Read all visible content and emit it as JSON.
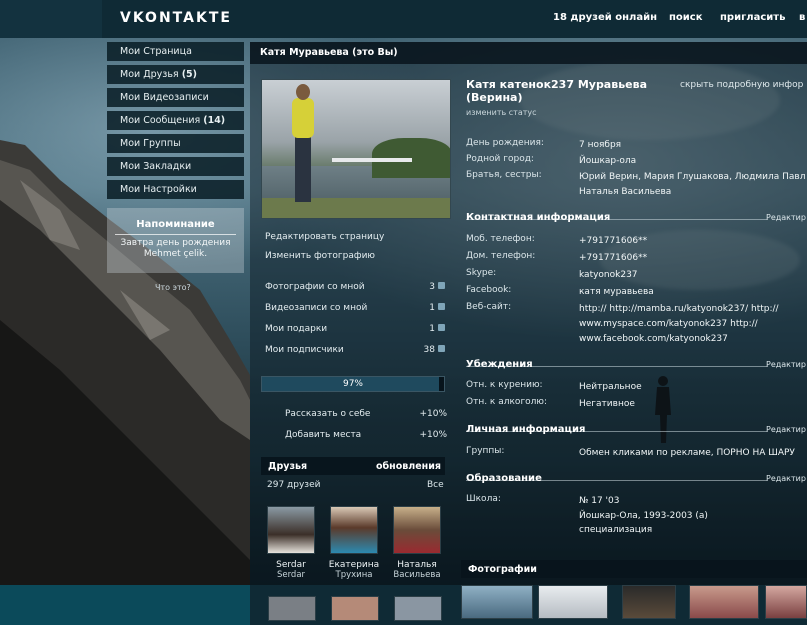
{
  "header": {
    "logo": "VKONTAKTE",
    "nav": [
      "18 друзей онлайн",
      "поиск",
      "пригласить",
      "в"
    ]
  },
  "sidebar": {
    "items": [
      {
        "label": "Мои Страница",
        "count": ""
      },
      {
        "label": "Мои Друзья",
        "count": "(5)"
      },
      {
        "label": "Мои Видеозаписи",
        "count": ""
      },
      {
        "label": "Мои Сообщения",
        "count": "(14)"
      },
      {
        "label": "Мои Группы",
        "count": ""
      },
      {
        "label": "Мои Закладки",
        "count": ""
      },
      {
        "label": "Мои Настройки",
        "count": ""
      }
    ],
    "reminder": {
      "title": "Напоминание",
      "text1": "Завтра день рождения",
      "text2": "Mehmet çelik."
    },
    "what_link": "Что это?"
  },
  "profile": {
    "header_name": "Катя Муравьева (это Вы)",
    "edit_page": "Редактировать страницу",
    "change_photo": "Изменить фотографию",
    "stats": [
      {
        "label": "Фотографии со мной",
        "count": "3"
      },
      {
        "label": "Видеозаписи со мной",
        "count": "1"
      },
      {
        "label": "Мои подарки",
        "count": "1"
      },
      {
        "label": "Мои подписчики",
        "count": "38"
      }
    ],
    "completion": {
      "label": "97%",
      "value": 0.97
    },
    "tips": [
      {
        "label": "Рассказать о себе",
        "pct": "+10%"
      },
      {
        "label": "Добавить места",
        "pct": "+10%"
      }
    ]
  },
  "friends": {
    "title": "Друзья",
    "updates": "обновления",
    "count": "297 друзей",
    "all": "Все",
    "list": [
      {
        "first": "Serdar",
        "last": "Serdar"
      },
      {
        "first": "Екатерина",
        "last": "Трухина"
      },
      {
        "first": "Наталья",
        "last": "Васильева"
      }
    ]
  },
  "info": {
    "name_line1": "Катя катенок237 Муравьева",
    "name_line2": "(Верина)",
    "status": "изменить статус",
    "hide_details": "скрыть подробную инфор",
    "basic": [
      {
        "key": "День рождения:",
        "value": "7 ноября"
      },
      {
        "key": "Родной город:",
        "value": "Йошкар-ола"
      },
      {
        "key": "Братья, сестры:",
        "value": "Юрий Верин, Мария Глушакова, Людмила Павл Наталья Васильева"
      }
    ],
    "contact_title": "Контактная информация",
    "contact": [
      {
        "key": "Моб. телефон:",
        "value": "+791771606**"
      },
      {
        "key": "Дом. телефон:",
        "value": "+791771606**"
      },
      {
        "key": "Skype:",
        "value": "katyonok237"
      },
      {
        "key": "Facebook:",
        "value": "катя муравьева"
      },
      {
        "key": "Веб-сайт:",
        "value": "http:// http://mamba.ru/katyonok237/ http:// www.myspace.com/katyonok237 http:// www.facebook.com/katyonok237"
      }
    ],
    "beliefs_title": "Убеждения",
    "beliefs": [
      {
        "key": "Отн. к курению:",
        "value": "Нейтральное"
      },
      {
        "key": "Отн. к алкоголю:",
        "value": "Негативное"
      }
    ],
    "personal_title": "Личная информация",
    "personal": [
      {
        "key": "Группы:",
        "value": "Обмен кликами по рекламе, ПОРНО НА ШАРУ"
      }
    ],
    "education_title": "Образование",
    "education": [
      {
        "key": "Школа:",
        "value": "№ 17 '03"
      },
      {
        "key": "",
        "value": "Йошкар-Ола, 1993-2003 (а)"
      },
      {
        "key": "",
        "value": "специализация"
      }
    ],
    "edit_label": "Редактир",
    "photos_title": "Фотографии"
  }
}
